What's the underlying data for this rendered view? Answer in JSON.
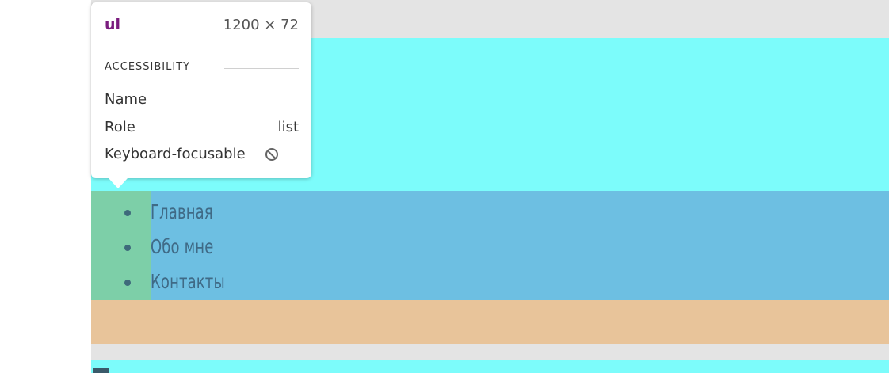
{
  "inspector": {
    "tag": "ul",
    "dimensions": "1200 × 72",
    "accessibility_title": "ACCESSIBILITY",
    "rows": {
      "name_label": "Name",
      "name_value": "",
      "role_label": "Role",
      "role_value": "list",
      "keyboard_label": "Keyboard-focusable",
      "keyboard_icon": "not-allowed-icon"
    }
  },
  "nav": {
    "items": [
      {
        "label": "Главная"
      },
      {
        "label": "Обо мне"
      },
      {
        "label": "Контакты"
      }
    ]
  },
  "colors": {
    "margin": "#7cfcfb",
    "content": "#6dbfe2",
    "padding": "#7dcfa8",
    "margin_bottom": "#e8c49a",
    "page": "#e4e4e4",
    "tag": "#7a1c7e",
    "link": "#3f6a86"
  }
}
